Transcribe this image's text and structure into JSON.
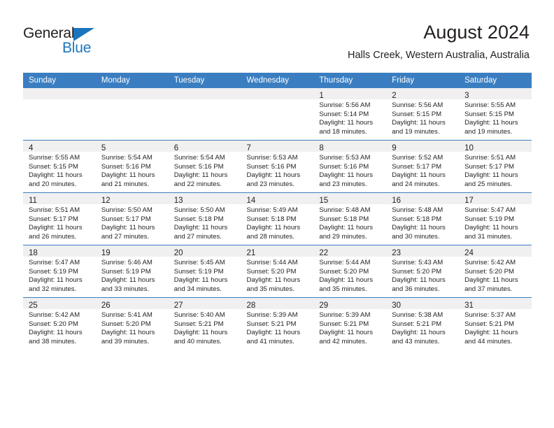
{
  "branding": {
    "logo_text_primary": "General",
    "logo_text_secondary": "Blue",
    "logo_triangle_icon": "triangle-icon",
    "accent_color": "#1b75bc"
  },
  "header": {
    "title": "August 2024",
    "subtitle": "Halls Creek, Western Australia, Australia"
  },
  "colors": {
    "header_row_bg": "#3a7ec1",
    "header_row_text": "#ffffff",
    "daynum_band_bg": "#f0f0f0",
    "grid_line": "#3a7ec1",
    "text": "#231f20"
  },
  "calendar": {
    "weekday_headers": [
      "Sunday",
      "Monday",
      "Tuesday",
      "Wednesday",
      "Thursday",
      "Friday",
      "Saturday"
    ],
    "weeks": [
      [
        {
          "day": "",
          "lines": []
        },
        {
          "day": "",
          "lines": []
        },
        {
          "day": "",
          "lines": []
        },
        {
          "day": "",
          "lines": []
        },
        {
          "day": "1",
          "lines": [
            "Sunrise: 5:56 AM",
            "Sunset: 5:14 PM",
            "Daylight: 11 hours",
            "and 18 minutes."
          ]
        },
        {
          "day": "2",
          "lines": [
            "Sunrise: 5:56 AM",
            "Sunset: 5:15 PM",
            "Daylight: 11 hours",
            "and 19 minutes."
          ]
        },
        {
          "day": "3",
          "lines": [
            "Sunrise: 5:55 AM",
            "Sunset: 5:15 PM",
            "Daylight: 11 hours",
            "and 19 minutes."
          ]
        }
      ],
      [
        {
          "day": "4",
          "lines": [
            "Sunrise: 5:55 AM",
            "Sunset: 5:15 PM",
            "Daylight: 11 hours",
            "and 20 minutes."
          ]
        },
        {
          "day": "5",
          "lines": [
            "Sunrise: 5:54 AM",
            "Sunset: 5:16 PM",
            "Daylight: 11 hours",
            "and 21 minutes."
          ]
        },
        {
          "day": "6",
          "lines": [
            "Sunrise: 5:54 AM",
            "Sunset: 5:16 PM",
            "Daylight: 11 hours",
            "and 22 minutes."
          ]
        },
        {
          "day": "7",
          "lines": [
            "Sunrise: 5:53 AM",
            "Sunset: 5:16 PM",
            "Daylight: 11 hours",
            "and 23 minutes."
          ]
        },
        {
          "day": "8",
          "lines": [
            "Sunrise: 5:53 AM",
            "Sunset: 5:16 PM",
            "Daylight: 11 hours",
            "and 23 minutes."
          ]
        },
        {
          "day": "9",
          "lines": [
            "Sunrise: 5:52 AM",
            "Sunset: 5:17 PM",
            "Daylight: 11 hours",
            "and 24 minutes."
          ]
        },
        {
          "day": "10",
          "lines": [
            "Sunrise: 5:51 AM",
            "Sunset: 5:17 PM",
            "Daylight: 11 hours",
            "and 25 minutes."
          ]
        }
      ],
      [
        {
          "day": "11",
          "lines": [
            "Sunrise: 5:51 AM",
            "Sunset: 5:17 PM",
            "Daylight: 11 hours",
            "and 26 minutes."
          ]
        },
        {
          "day": "12",
          "lines": [
            "Sunrise: 5:50 AM",
            "Sunset: 5:17 PM",
            "Daylight: 11 hours",
            "and 27 minutes."
          ]
        },
        {
          "day": "13",
          "lines": [
            "Sunrise: 5:50 AM",
            "Sunset: 5:18 PM",
            "Daylight: 11 hours",
            "and 27 minutes."
          ]
        },
        {
          "day": "14",
          "lines": [
            "Sunrise: 5:49 AM",
            "Sunset: 5:18 PM",
            "Daylight: 11 hours",
            "and 28 minutes."
          ]
        },
        {
          "day": "15",
          "lines": [
            "Sunrise: 5:48 AM",
            "Sunset: 5:18 PM",
            "Daylight: 11 hours",
            "and 29 minutes."
          ]
        },
        {
          "day": "16",
          "lines": [
            "Sunrise: 5:48 AM",
            "Sunset: 5:18 PM",
            "Daylight: 11 hours",
            "and 30 minutes."
          ]
        },
        {
          "day": "17",
          "lines": [
            "Sunrise: 5:47 AM",
            "Sunset: 5:19 PM",
            "Daylight: 11 hours",
            "and 31 minutes."
          ]
        }
      ],
      [
        {
          "day": "18",
          "lines": [
            "Sunrise: 5:47 AM",
            "Sunset: 5:19 PM",
            "Daylight: 11 hours",
            "and 32 minutes."
          ]
        },
        {
          "day": "19",
          "lines": [
            "Sunrise: 5:46 AM",
            "Sunset: 5:19 PM",
            "Daylight: 11 hours",
            "and 33 minutes."
          ]
        },
        {
          "day": "20",
          "lines": [
            "Sunrise: 5:45 AM",
            "Sunset: 5:19 PM",
            "Daylight: 11 hours",
            "and 34 minutes."
          ]
        },
        {
          "day": "21",
          "lines": [
            "Sunrise: 5:44 AM",
            "Sunset: 5:20 PM",
            "Daylight: 11 hours",
            "and 35 minutes."
          ]
        },
        {
          "day": "22",
          "lines": [
            "Sunrise: 5:44 AM",
            "Sunset: 5:20 PM",
            "Daylight: 11 hours",
            "and 35 minutes."
          ]
        },
        {
          "day": "23",
          "lines": [
            "Sunrise: 5:43 AM",
            "Sunset: 5:20 PM",
            "Daylight: 11 hours",
            "and 36 minutes."
          ]
        },
        {
          "day": "24",
          "lines": [
            "Sunrise: 5:42 AM",
            "Sunset: 5:20 PM",
            "Daylight: 11 hours",
            "and 37 minutes."
          ]
        }
      ],
      [
        {
          "day": "25",
          "lines": [
            "Sunrise: 5:42 AM",
            "Sunset: 5:20 PM",
            "Daylight: 11 hours",
            "and 38 minutes."
          ]
        },
        {
          "day": "26",
          "lines": [
            "Sunrise: 5:41 AM",
            "Sunset: 5:20 PM",
            "Daylight: 11 hours",
            "and 39 minutes."
          ]
        },
        {
          "day": "27",
          "lines": [
            "Sunrise: 5:40 AM",
            "Sunset: 5:21 PM",
            "Daylight: 11 hours",
            "and 40 minutes."
          ]
        },
        {
          "day": "28",
          "lines": [
            "Sunrise: 5:39 AM",
            "Sunset: 5:21 PM",
            "Daylight: 11 hours",
            "and 41 minutes."
          ]
        },
        {
          "day": "29",
          "lines": [
            "Sunrise: 5:39 AM",
            "Sunset: 5:21 PM",
            "Daylight: 11 hours",
            "and 42 minutes."
          ]
        },
        {
          "day": "30",
          "lines": [
            "Sunrise: 5:38 AM",
            "Sunset: 5:21 PM",
            "Daylight: 11 hours",
            "and 43 minutes."
          ]
        },
        {
          "day": "31",
          "lines": [
            "Sunrise: 5:37 AM",
            "Sunset: 5:21 PM",
            "Daylight: 11 hours",
            "and 44 minutes."
          ]
        }
      ]
    ]
  }
}
